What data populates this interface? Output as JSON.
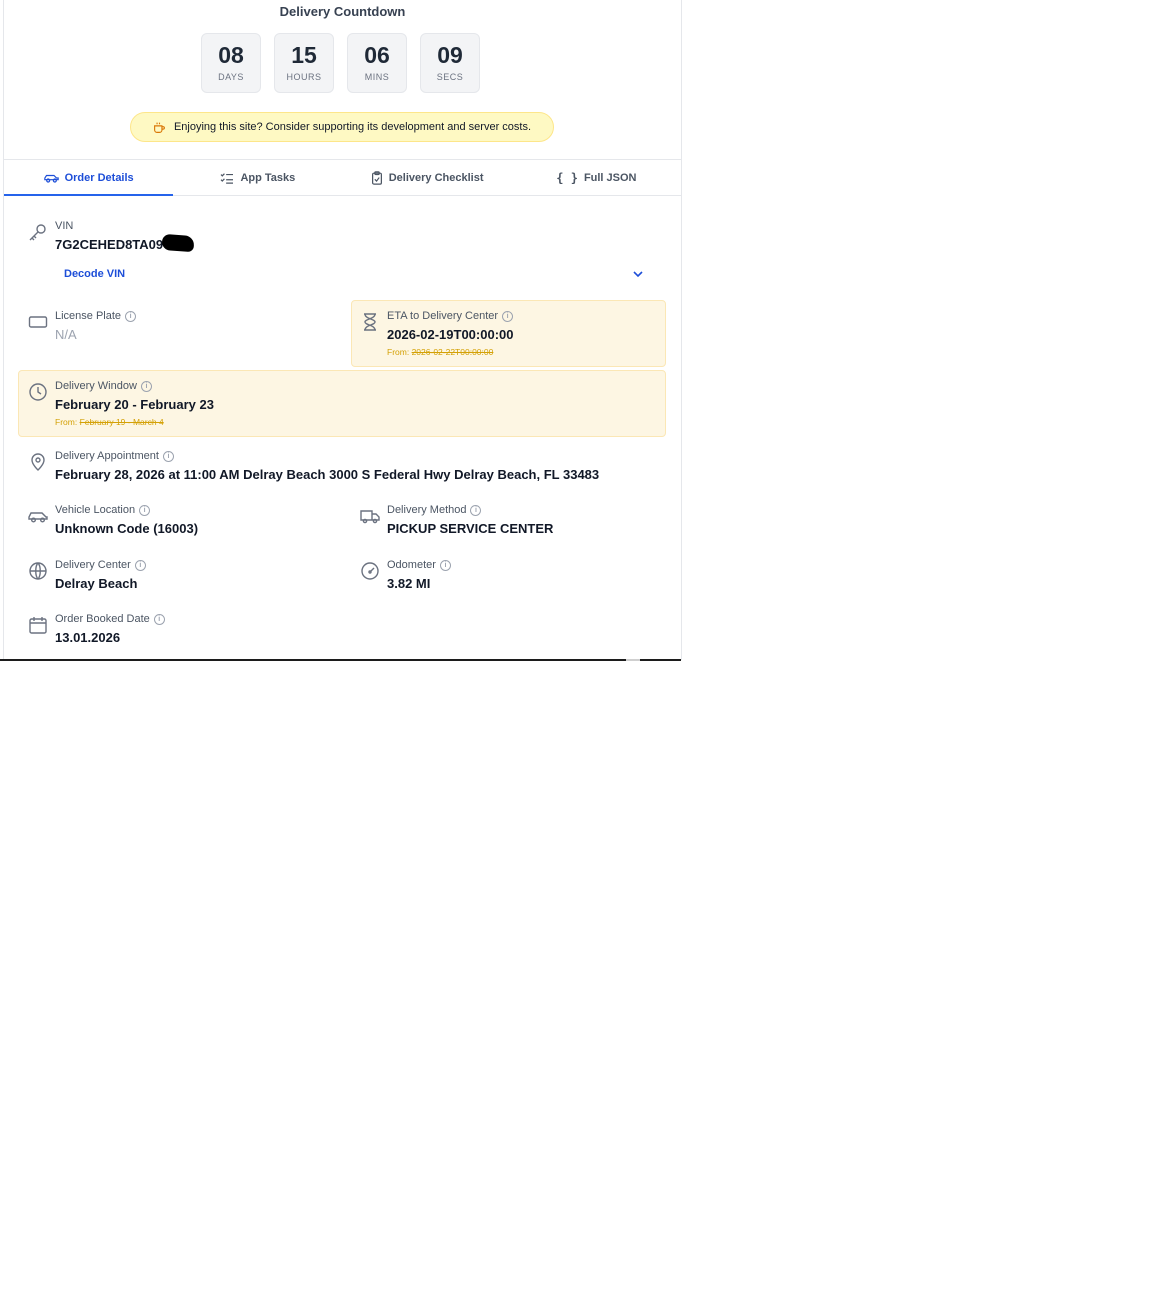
{
  "countdown": {
    "title": "Delivery Countdown",
    "units": [
      {
        "value": "08",
        "label": "DAYS"
      },
      {
        "value": "15",
        "label": "HOURS"
      },
      {
        "value": "06",
        "label": "MINS"
      },
      {
        "value": "09",
        "label": "SECS"
      }
    ]
  },
  "support_banner": {
    "text": "Enjoying this site? Consider supporting its development and server costs.",
    "icon": "coffee-icon"
  },
  "tabs": [
    {
      "label": "Order Details",
      "icon": "car-icon",
      "active": true
    },
    {
      "label": "App Tasks",
      "icon": "checklist-icon",
      "active": false
    },
    {
      "label": "Delivery Checklist",
      "icon": "clipboard-icon",
      "active": false
    },
    {
      "label": "Full JSON",
      "icon": "braces-icon",
      "active": false
    }
  ],
  "details": {
    "vin": {
      "label": "VIN",
      "value": "7G2CEHED8TA09",
      "decode_label": "Decode VIN"
    },
    "license_plate": {
      "label": "License Plate",
      "value": "N/A"
    },
    "eta": {
      "label": "ETA to Delivery Center",
      "value": "2026-02-19T00:00:00",
      "from_label": "From:",
      "from_value": "2026-02-22T00:00:00"
    },
    "delivery_window": {
      "label": "Delivery Window",
      "value": "February 20 - February 23",
      "from_label": "From:",
      "from_value": "February 19 - March 4"
    },
    "appointment": {
      "label": "Delivery Appointment",
      "value": "February 28, 2026 at 11:00 AM Delray Beach 3000 S Federal Hwy Delray Beach, FL 33483"
    },
    "vehicle_location": {
      "label": "Vehicle Location",
      "value": "Unknown Code (16003)"
    },
    "delivery_method": {
      "label": "Delivery Method",
      "value": "PICKUP SERVICE CENTER"
    },
    "delivery_center": {
      "label": "Delivery Center",
      "value": "Delray Beach"
    },
    "odometer": {
      "label": "Odometer",
      "value": "3.82 MI"
    },
    "order_booked": {
      "label": "Order Booked Date",
      "value": "13.01.2026"
    }
  },
  "colors": {
    "accent": "#2563eb",
    "highlight_bg": "#fdf6e3",
    "banner_bg": "#fef9c3",
    "from_text": "#d4a106"
  }
}
